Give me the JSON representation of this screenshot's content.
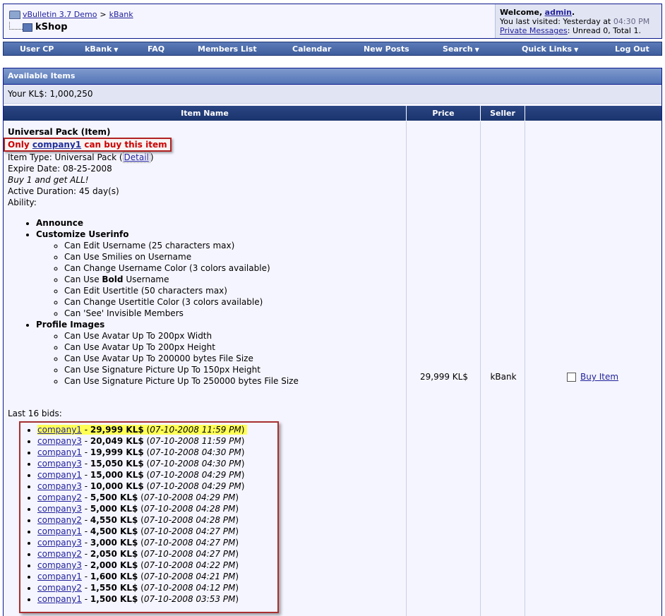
{
  "breadcrumb": {
    "home": "vBulletin 3.7 Demo",
    "separator": ">",
    "parent": "kBank",
    "current": "kShop"
  },
  "welcome": {
    "greeting": "Welcome,",
    "user": "admin",
    "period": ".",
    "last_visit_label": "You last visited: Yesterday at",
    "last_visit_time": "04:30 PM",
    "pm_link": "Private Messages",
    "pm_status": ": Unread 0, Total 1."
  },
  "navbar": [
    {
      "label": "User CP",
      "dropdown": false
    },
    {
      "label": "kBank",
      "dropdown": true
    },
    {
      "label": "FAQ",
      "dropdown": false
    },
    {
      "label": "Members List",
      "dropdown": false
    },
    {
      "label": "Calendar",
      "dropdown": false
    },
    {
      "label": "New Posts",
      "dropdown": false
    },
    {
      "label": "Search",
      "dropdown": true
    },
    {
      "label": "Quick Links",
      "dropdown": true
    },
    {
      "label": "Log Out",
      "dropdown": false
    }
  ],
  "section": {
    "title": "Available Items",
    "balance": "Your KL$: 1,000,250"
  },
  "columns": {
    "name": "Item Name",
    "price": "Price",
    "seller": "Seller",
    "action": ""
  },
  "item": {
    "name": "Universal Pack (Item)",
    "only_prefix": "Only",
    "only_user": "company1",
    "only_suffix": "can buy this item",
    "type_label": "Item Type: Universal Pack",
    "detail_link": "Detail",
    "expire": "Expire Date: 08-25-2008",
    "tagline": "Buy 1 and get ALL!",
    "duration": "Active Duration: 45 day(s)",
    "ability_label": "Ability:",
    "abilities": {
      "announce": "Announce",
      "customize": "Customize Userinfo",
      "customize_items": [
        "Can Edit Username (25 characters max)",
        "Can Use Smilies on Username",
        "Can Change Username Color (3 colors available)",
        "Can Edit Usertitle (50 characters max)",
        "Can Change Usertitle Color (3 colors available)",
        "Can 'See' Invisible Members"
      ],
      "bold_prefix": "Can Use",
      "bold_word": "Bold",
      "bold_suffix": "Username",
      "profile": "Profile Images",
      "profile_items": [
        "Can Use Avatar Up To 200px Width",
        "Can Use Avatar Up To 200px Height",
        "Can Use Avatar Up To 200000 bytes File Size",
        "Can Use Signature Picture Up To 150px Height",
        "Can Use Signature Picture Up To 250000 bytes File Size"
      ]
    },
    "bids_title": "Last 16 bids:",
    "price": "29,999 KL$",
    "seller": "kBank",
    "buy_label": "Buy Item"
  },
  "bids": [
    {
      "user": "company1",
      "amount": "29,999 KL$",
      "date": "07-10-2008 11:59 PM",
      "highlight": true
    },
    {
      "user": "company3",
      "amount": "20,049 KL$",
      "date": "07-10-2008 11:59 PM"
    },
    {
      "user": "company1",
      "amount": "19,999 KL$",
      "date": "07-10-2008 04:30 PM"
    },
    {
      "user": "company3",
      "amount": "15,050 KL$",
      "date": "07-10-2008 04:30 PM"
    },
    {
      "user": "company1",
      "amount": "15,000 KL$",
      "date": "07-10-2008 04:29 PM"
    },
    {
      "user": "company3",
      "amount": "10,000 KL$",
      "date": "07-10-2008 04:29 PM"
    },
    {
      "user": "company2",
      "amount": "5,500 KL$",
      "date": "07-10-2008 04:29 PM"
    },
    {
      "user": "company3",
      "amount": "5,000 KL$",
      "date": "07-10-2008 04:28 PM"
    },
    {
      "user": "company2",
      "amount": "4,550 KL$",
      "date": "07-10-2008 04:28 PM"
    },
    {
      "user": "company1",
      "amount": "4,500 KL$",
      "date": "07-10-2008 04:27 PM"
    },
    {
      "user": "company3",
      "amount": "3,000 KL$",
      "date": "07-10-2008 04:27 PM"
    },
    {
      "user": "company2",
      "amount": "2,050 KL$",
      "date": "07-10-2008 04:27 PM"
    },
    {
      "user": "company3",
      "amount": "2,000 KL$",
      "date": "07-10-2008 04:22 PM"
    },
    {
      "user": "company1",
      "amount": "1,600 KL$",
      "date": "07-10-2008 04:21 PM"
    },
    {
      "user": "company2",
      "amount": "1,550 KL$",
      "date": "07-10-2008 04:12 PM"
    },
    {
      "user": "company1",
      "amount": "1,500 KL$",
      "date": "07-10-2008 03:53 PM"
    }
  ],
  "colors": {
    "header_bg": "#f5f5ff",
    "navbar": "#3e5d9c",
    "table_head": "#19346d",
    "link": "#22229c",
    "alert": "#cc0000",
    "highlight": "#ffff55"
  }
}
